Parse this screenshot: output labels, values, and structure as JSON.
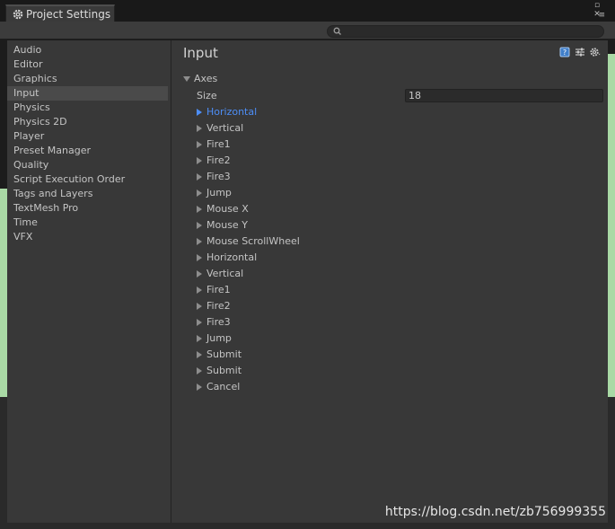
{
  "window": {
    "tab_title": "Project Settings"
  },
  "sidebar": {
    "items": [
      {
        "label": "Audio"
      },
      {
        "label": "Editor"
      },
      {
        "label": "Graphics"
      },
      {
        "label": "Input",
        "selected": true
      },
      {
        "label": "Physics"
      },
      {
        "label": "Physics 2D"
      },
      {
        "label": "Player"
      },
      {
        "label": "Preset Manager"
      },
      {
        "label": "Quality"
      },
      {
        "label": "Script Execution Order"
      },
      {
        "label": "Tags and Layers"
      },
      {
        "label": "TextMesh Pro"
      },
      {
        "label": "Time"
      },
      {
        "label": "VFX"
      }
    ]
  },
  "main": {
    "title": "Input",
    "axes_label": "Axes",
    "size_label": "Size",
    "size_value": "18",
    "axes": [
      {
        "label": "Horizontal",
        "active": true
      },
      {
        "label": "Vertical"
      },
      {
        "label": "Fire1"
      },
      {
        "label": "Fire2"
      },
      {
        "label": "Fire3"
      },
      {
        "label": "Jump"
      },
      {
        "label": "Mouse X"
      },
      {
        "label": "Mouse Y"
      },
      {
        "label": "Mouse ScrollWheel"
      },
      {
        "label": "Horizontal"
      },
      {
        "label": "Vertical"
      },
      {
        "label": "Fire1"
      },
      {
        "label": "Fire2"
      },
      {
        "label": "Fire3"
      },
      {
        "label": "Jump"
      },
      {
        "label": "Submit"
      },
      {
        "label": "Submit"
      },
      {
        "label": "Cancel"
      }
    ]
  },
  "watermark": "https://blog.csdn.net/zb756999355",
  "colors": {
    "accent": "#4d8ef7",
    "panel": "#383838",
    "scene_green": "#a9d9a5"
  }
}
